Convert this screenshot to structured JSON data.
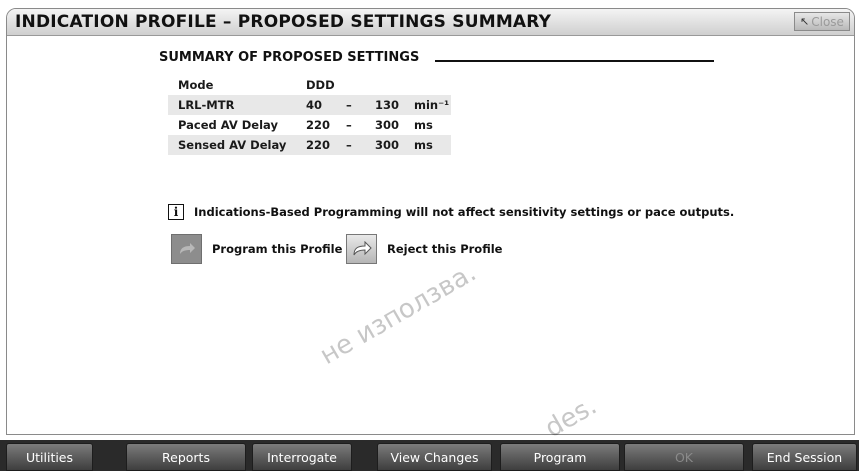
{
  "window": {
    "title": "INDICATION PROFILE – PROPOSED SETTINGS SUMMARY",
    "close_label": "Close"
  },
  "summary": {
    "heading": "SUMMARY OF PROPOSED SETTINGS",
    "rows": [
      {
        "label": "Mode",
        "value1": "DDD",
        "dash": "",
        "value2": "",
        "unit": ""
      },
      {
        "label": "LRL-MTR",
        "value1": "40",
        "dash": "–",
        "value2": "130",
        "unit": "min⁻¹"
      },
      {
        "label": "Paced AV Delay",
        "value1": "220",
        "dash": "–",
        "value2": "300",
        "unit": "ms"
      },
      {
        "label": "Sensed AV Delay",
        "value1": "220",
        "dash": "–",
        "value2": "300",
        "unit": "ms"
      }
    ]
  },
  "info": {
    "icon": "info-icon",
    "glyph": "i",
    "text": "Indications-Based Programming will not affect sensitivity settings or pace outputs."
  },
  "actions": {
    "program_label": "Program this Profile",
    "reject_label": "Reject this Profile"
  },
  "watermark": {
    "line1": "не използва.",
    "line2": "des."
  },
  "toolbar": {
    "buttons": [
      {
        "label": "Utilities",
        "enabled": true
      },
      {
        "label": "Reports",
        "enabled": true
      },
      {
        "label": "Interrogate",
        "enabled": true
      },
      {
        "label": "View Changes",
        "enabled": true
      },
      {
        "label": "Program",
        "enabled": true
      },
      {
        "label": "OK",
        "enabled": false
      },
      {
        "label": "End Session",
        "enabled": true
      }
    ]
  },
  "colors": {
    "bottom_bar": "#2a2a2a",
    "row_shade": "#e8e8e8",
    "program_icon_bg": "#8d8d8d"
  }
}
